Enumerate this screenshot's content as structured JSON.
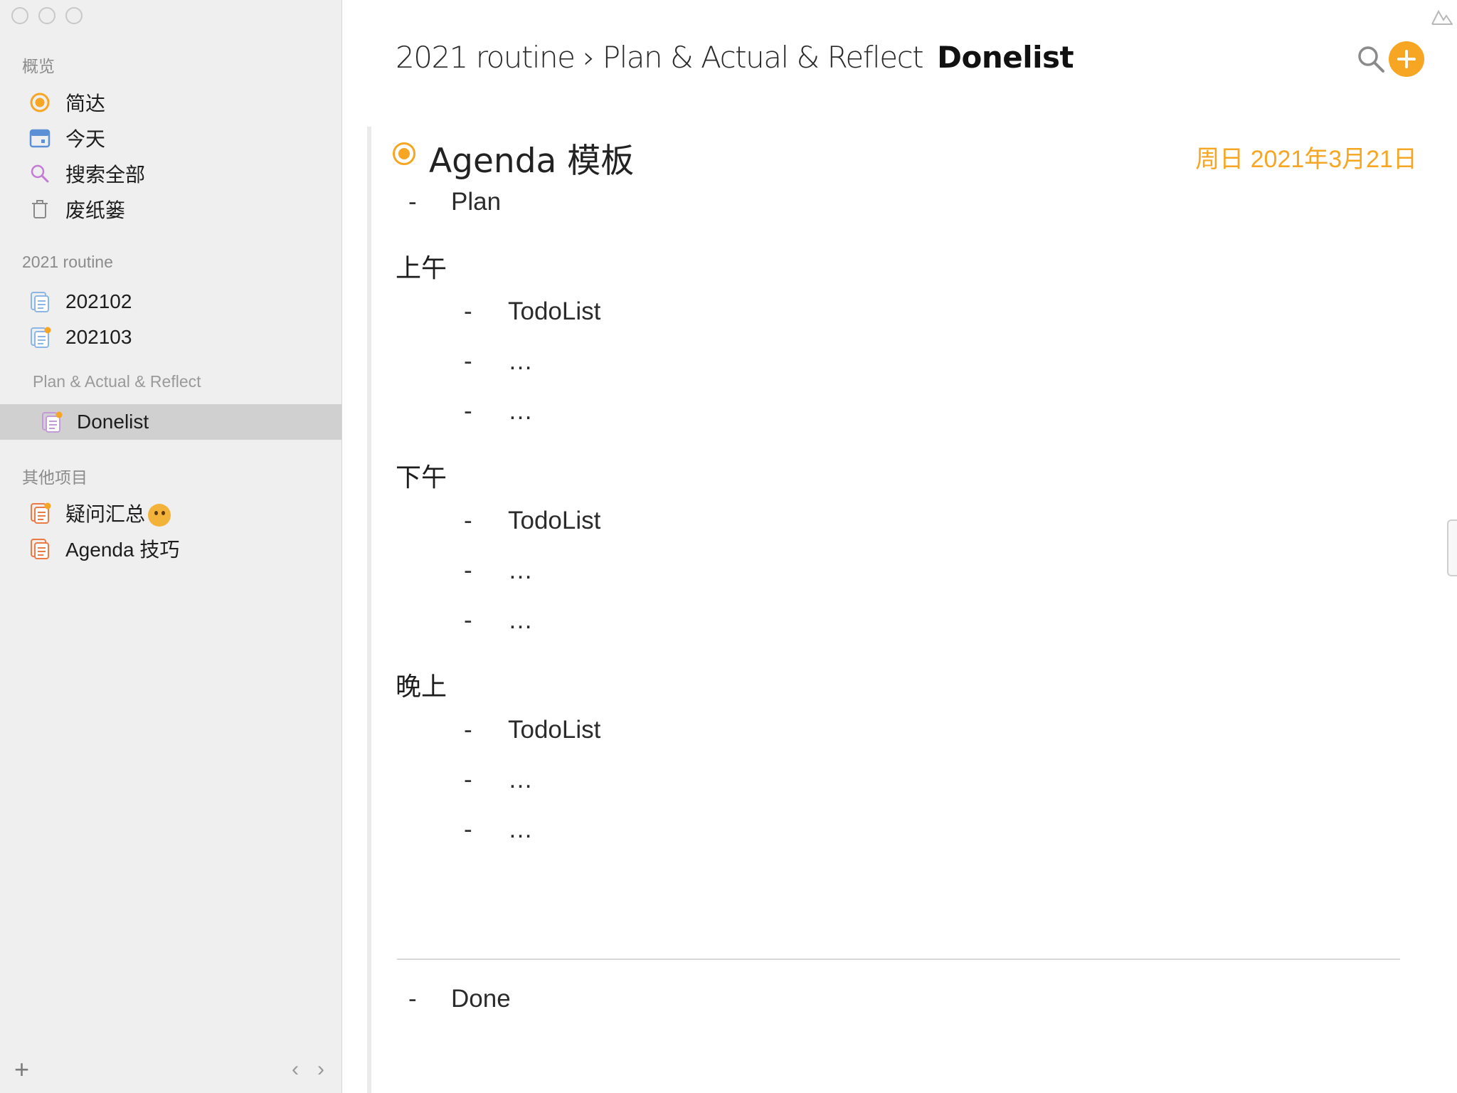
{
  "sidebar": {
    "overview_label": "概览",
    "overview_items": [
      {
        "label": "简达",
        "icon": "agenda-circle-icon"
      },
      {
        "label": "今天",
        "icon": "calendar-icon"
      },
      {
        "label": "搜索全部",
        "icon": "search-icon"
      },
      {
        "label": "废纸篓",
        "icon": "trash-icon"
      }
    ],
    "routine_label": "2021 routine",
    "routine_items": [
      {
        "label": "202102",
        "icon": "project-icon"
      },
      {
        "label": "202103",
        "icon": "project-icon"
      }
    ],
    "category_label": "Plan & Actual & Reflect",
    "selected_item": {
      "label": "Donelist",
      "icon": "project-icon"
    },
    "other_label": "其他项目",
    "other_items": [
      {
        "label": "疑问汇总",
        "icon": "project-icon",
        "emoji": "thinking-face"
      },
      {
        "label": "Agenda 技巧",
        "icon": "project-icon"
      }
    ],
    "bottom": {
      "add": "+",
      "back": "‹",
      "forward": "›"
    }
  },
  "header": {
    "crumb_1": "2021 routine",
    "separator": "›",
    "crumb_2": "Plan & Actual & Reflect",
    "current": "Donelist"
  },
  "note": {
    "title": "Agenda 模板",
    "date": "周日 2021年3月21日",
    "plan_label": "Plan",
    "sections": [
      {
        "heading": "上午",
        "items": [
          "TodoList",
          "…",
          "…"
        ]
      },
      {
        "heading": "下午",
        "items": [
          "TodoList",
          "…",
          "…"
        ]
      },
      {
        "heading": "晚上",
        "items": [
          "TodoList",
          "…",
          "…"
        ]
      }
    ],
    "done_label": "Done",
    "dash": "-"
  },
  "colors": {
    "accent": "#f6a623",
    "sidebar_bg": "#efefef",
    "selected_bg": "#d0d0d0",
    "project_blue": "#5b9bd5",
    "project_orange": "#e8733a",
    "project_purple": "#b58bd6"
  }
}
